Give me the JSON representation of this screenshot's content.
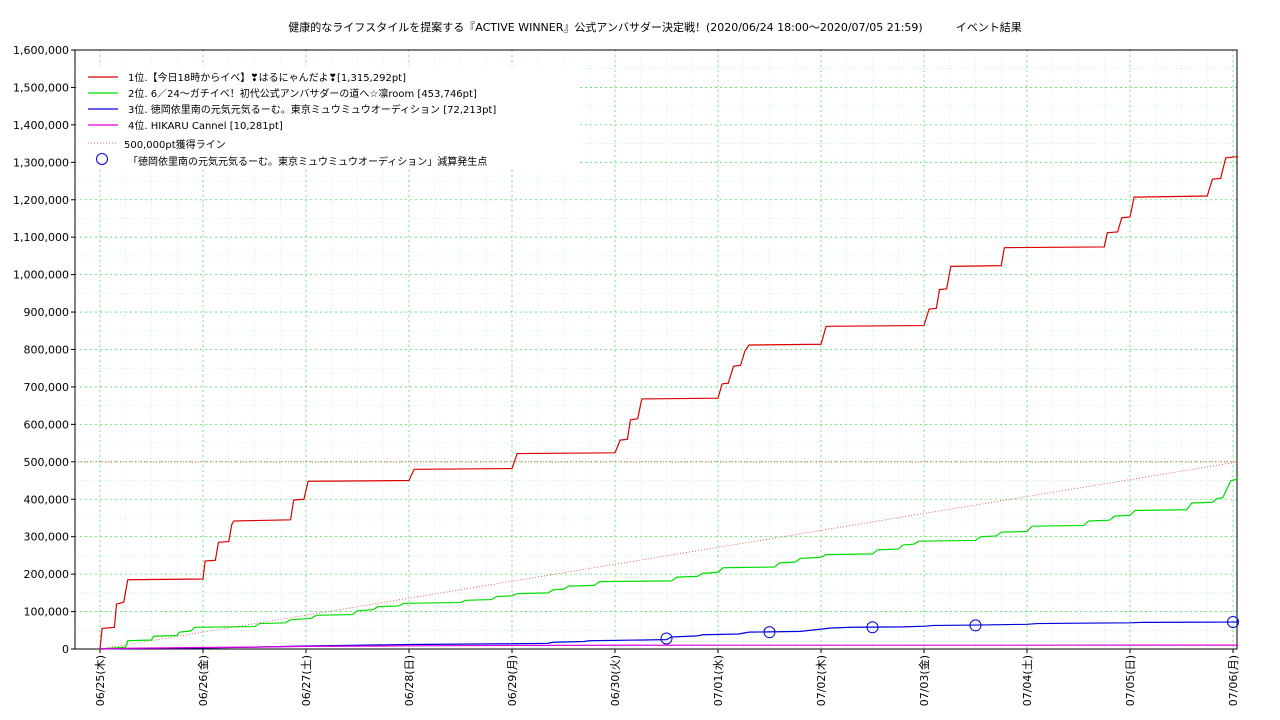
{
  "chart_data": {
    "type": "line",
    "title": "健康的なライフスタイルを提案する『ACTIVE WINNER』公式アンバサダー決定戦！(2020/06/24 18:00〜2020/07/05 21:59)　　　イベント結果",
    "y_ticks": [
      "0",
      "100,000",
      "200,000",
      "300,000",
      "400,000",
      "500,000",
      "600,000",
      "700,000",
      "800,000",
      "900,000",
      "1,000,000",
      "1,100,000",
      "1,200,000",
      "1,300,000",
      "1,400,000",
      "1,500,000",
      "1,600,000"
    ],
    "x_ticks": [
      "06/25(木)",
      "06/26(金)",
      "06/27(土)",
      "06/28(日)",
      "06/29(月)",
      "06/30(火)",
      "07/01(水)",
      "07/02(木)",
      "07/03(金)",
      "07/04(土)",
      "07/05(日)",
      "07/06(月)"
    ],
    "ylim": [
      0,
      1600000
    ],
    "xlim": [
      0,
      11.3
    ],
    "grid": true,
    "legend_position": "top-left",
    "series": [
      {
        "name": "1位.【今日18時からイベ】❣はるにゃんだよ❣[1,315,292pt]",
        "color": "#dd0000",
        "points": [
          [
            0,
            0
          ],
          [
            0.02,
            55000
          ],
          [
            0.14,
            58000
          ],
          [
            0.16,
            120000
          ],
          [
            0.23,
            125000
          ],
          [
            0.27,
            185000
          ],
          [
            1,
            187000
          ],
          [
            1.02,
            235000
          ],
          [
            1.12,
            237000
          ],
          [
            1.15,
            285000
          ],
          [
            1.25,
            287000
          ],
          [
            1.28,
            333000
          ],
          [
            1.3,
            342000
          ],
          [
            1.85,
            345000
          ],
          [
            1.88,
            398000
          ],
          [
            1.98,
            400000
          ],
          [
            2.02,
            448000
          ],
          [
            3.0,
            450000
          ],
          [
            3.05,
            480000
          ],
          [
            4.0,
            482000
          ],
          [
            4.05,
            522000
          ],
          [
            5.0,
            524000
          ],
          [
            5.05,
            558000
          ],
          [
            5.12,
            560000
          ],
          [
            5.15,
            612000
          ],
          [
            5.22,
            615000
          ],
          [
            5.26,
            668000
          ],
          [
            6.0,
            670000
          ],
          [
            6.04,
            708000
          ],
          [
            6.1,
            710000
          ],
          [
            6.15,
            755000
          ],
          [
            6.22,
            758000
          ],
          [
            6.26,
            795000
          ],
          [
            6.3,
            812000
          ],
          [
            7.0,
            814000
          ],
          [
            7.05,
            862000
          ],
          [
            8.0,
            864000
          ],
          [
            8.05,
            908000
          ],
          [
            8.12,
            910000
          ],
          [
            8.15,
            960000
          ],
          [
            8.22,
            962000
          ],
          [
            8.26,
            1022000
          ],
          [
            8.75,
            1024000
          ],
          [
            8.78,
            1072000
          ],
          [
            9.75,
            1074000
          ],
          [
            9.78,
            1112000
          ],
          [
            9.88,
            1114000
          ],
          [
            9.92,
            1152000
          ],
          [
            10.0,
            1154000
          ],
          [
            10.04,
            1207000
          ],
          [
            10.75,
            1210000
          ],
          [
            10.8,
            1255000
          ],
          [
            10.88,
            1257000
          ],
          [
            10.93,
            1312000
          ],
          [
            11.05,
            1315292
          ]
        ]
      },
      {
        "name": "2位. 6／24〜ガチイベ！初代公式アンバサダーの道へ☆凛room [453,746pt]",
        "color": "#00dd00",
        "points": [
          [
            0,
            0
          ],
          [
            0.25,
            5000
          ],
          [
            0.27,
            22000
          ],
          [
            0.5,
            24000
          ],
          [
            0.52,
            34000
          ],
          [
            0.75,
            36000
          ],
          [
            0.77,
            45000
          ],
          [
            0.88,
            48000
          ],
          [
            0.92,
            58000
          ],
          [
            1.5,
            60000
          ],
          [
            1.55,
            68000
          ],
          [
            1.8,
            70000
          ],
          [
            1.85,
            78000
          ],
          [
            2.05,
            82000
          ],
          [
            2.1,
            90000
          ],
          [
            2.45,
            92000
          ],
          [
            2.5,
            102000
          ],
          [
            2.65,
            105000
          ],
          [
            2.7,
            113000
          ],
          [
            2.9,
            115000
          ],
          [
            2.95,
            122000
          ],
          [
            3.5,
            124000
          ],
          [
            3.55,
            130000
          ],
          [
            3.8,
            132000
          ],
          [
            3.85,
            140000
          ],
          [
            4.0,
            142000
          ],
          [
            4.05,
            148000
          ],
          [
            4.35,
            150000
          ],
          [
            4.4,
            158000
          ],
          [
            4.5,
            160000
          ],
          [
            4.55,
            168000
          ],
          [
            4.8,
            170000
          ],
          [
            4.85,
            180000
          ],
          [
            5.55,
            182000
          ],
          [
            5.6,
            192000
          ],
          [
            5.8,
            194000
          ],
          [
            5.85,
            202000
          ],
          [
            6.0,
            205000
          ],
          [
            6.05,
            217000
          ],
          [
            6.55,
            219000
          ],
          [
            6.6,
            230000
          ],
          [
            6.75,
            232000
          ],
          [
            6.8,
            242000
          ],
          [
            7.0,
            245000
          ],
          [
            7.05,
            252000
          ],
          [
            7.5,
            254000
          ],
          [
            7.55,
            265000
          ],
          [
            7.75,
            267000
          ],
          [
            7.8,
            278000
          ],
          [
            7.9,
            280000
          ],
          [
            7.95,
            288000
          ],
          [
            8.5,
            290000
          ],
          [
            8.55,
            300000
          ],
          [
            8.7,
            302000
          ],
          [
            8.75,
            312000
          ],
          [
            9.0,
            314000
          ],
          [
            9.05,
            328000
          ],
          [
            9.55,
            330000
          ],
          [
            9.6,
            342000
          ],
          [
            9.8,
            344000
          ],
          [
            9.85,
            355000
          ],
          [
            10.0,
            357000
          ],
          [
            10.05,
            370000
          ],
          [
            10.55,
            372000
          ],
          [
            10.6,
            390000
          ],
          [
            10.8,
            392000
          ],
          [
            10.85,
            402000
          ],
          [
            10.9,
            404000
          ],
          [
            10.98,
            450000
          ],
          [
            11.05,
            453746
          ]
        ]
      },
      {
        "name": "3位. 徳岡依里南の元気元気るーむ。東京ミュウミュウオーディション [72,213pt]",
        "color": "#0000dd",
        "points": [
          [
            0,
            0
          ],
          [
            0.5,
            2000
          ],
          [
            1.0,
            3000
          ],
          [
            1.5,
            5000
          ],
          [
            2.0,
            8000
          ],
          [
            2.5,
            10000
          ],
          [
            3.0,
            12000
          ],
          [
            3.5,
            13000
          ],
          [
            4.0,
            14000
          ],
          [
            4.35,
            15000
          ],
          [
            4.4,
            18000
          ],
          [
            4.7,
            20000
          ],
          [
            4.75,
            22000
          ],
          [
            5.5,
            25000
          ],
          [
            5.55,
            32000
          ],
          [
            5.8,
            35000
          ],
          [
            5.85,
            38000
          ],
          [
            6.2,
            40000
          ],
          [
            6.3,
            45000
          ],
          [
            6.8,
            47000
          ],
          [
            6.9,
            50000
          ],
          [
            7.0,
            53000
          ],
          [
            7.1,
            56000
          ],
          [
            7.3,
            58000
          ],
          [
            7.8,
            59000
          ],
          [
            8.0,
            61000
          ],
          [
            8.1,
            63000
          ],
          [
            8.5,
            64000
          ],
          [
            9.0,
            66000
          ],
          [
            9.1,
            68000
          ],
          [
            9.5,
            69000
          ],
          [
            10.0,
            70000
          ],
          [
            10.1,
            71000
          ],
          [
            10.5,
            71500
          ],
          [
            11.0,
            72000
          ],
          [
            11.05,
            72213
          ]
        ]
      },
      {
        "name": "4位. HIKARU Cannel [10,281pt]",
        "color": "#dd00dd",
        "points": [
          [
            0,
            0
          ],
          [
            0.3,
            2000
          ],
          [
            1.0,
            4000
          ],
          [
            1.5,
            5000
          ],
          [
            2.0,
            7000
          ],
          [
            3.0,
            8500
          ],
          [
            4.0,
            9500
          ],
          [
            5.0,
            10000
          ],
          [
            6.0,
            10200
          ],
          [
            11.05,
            10281
          ]
        ]
      }
    ],
    "reference_line": {
      "name": "500,000pt獲得ライン",
      "color": "#dd4444",
      "points": [
        [
          0,
          0
        ],
        [
          11.05,
          500000
        ]
      ]
    },
    "markers": {
      "name": "「徳岡依里南の元気元気るーむ。東京ミュウミュウオーディション」減算発生点",
      "color": "#0000dd",
      "points": [
        [
          5.5,
          28000
        ],
        [
          6.5,
          45000
        ],
        [
          7.5,
          58000
        ],
        [
          8.5,
          63000
        ],
        [
          11.0,
          72000
        ]
      ]
    }
  }
}
